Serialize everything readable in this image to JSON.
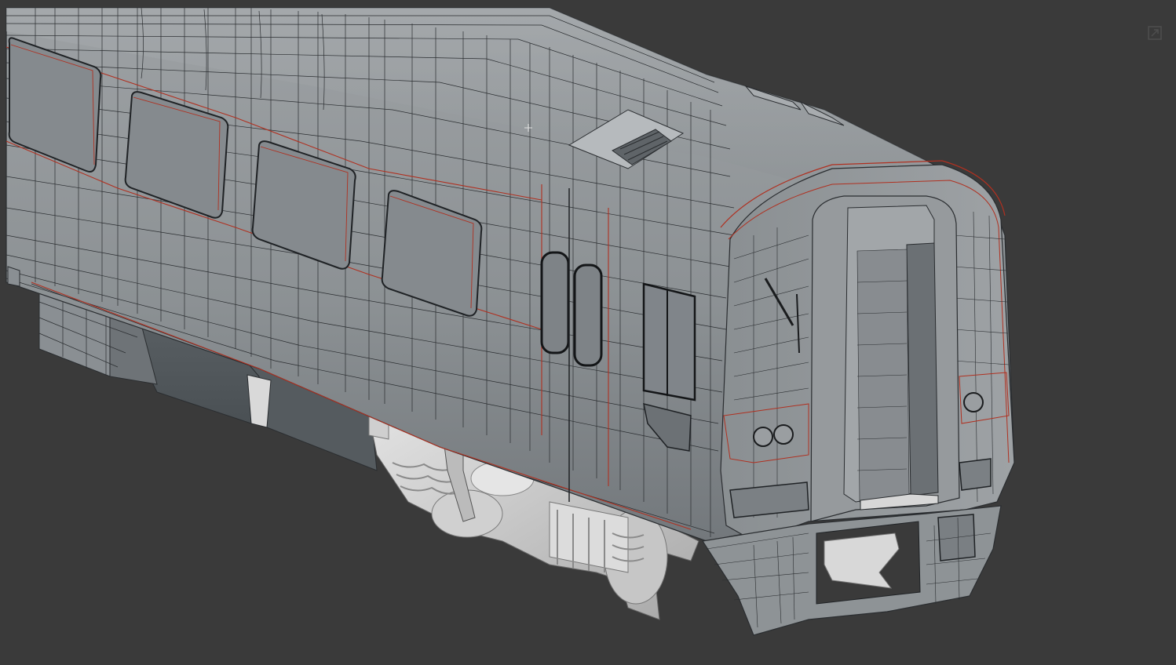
{
  "viewport": {
    "background": "#3a3a3a",
    "shading": "clay-wireframe",
    "model": "train-car",
    "body_color": "#8e9396",
    "wire_color": "#2a2d30",
    "seam_color": "#b03020",
    "bogie_color": "#cfcfcf"
  },
  "icons": {
    "maximize": "maximize-viewport-icon",
    "gizmo": "move-gizmo-icon"
  }
}
